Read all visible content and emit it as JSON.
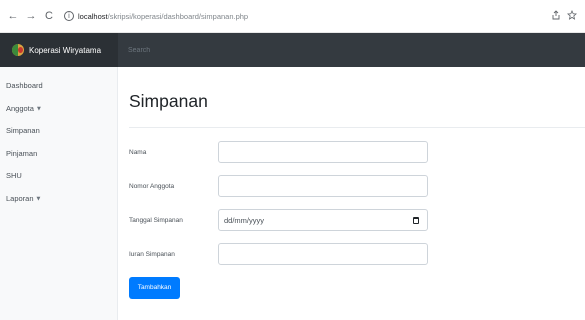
{
  "browser": {
    "back": "←",
    "forward": "→",
    "reload": "C",
    "info": "i",
    "url_host": "localhost",
    "url_path": "/skripsi/koperasi/dashboard/simpanan.php"
  },
  "navbar": {
    "brand": "Koperasi Wiryatama",
    "search_placeholder": "Search"
  },
  "sidebar": {
    "items": [
      {
        "label": "Dashboard"
      },
      {
        "label": "Anggota",
        "caret": "▼"
      },
      {
        "label": "Simpanan"
      },
      {
        "label": "Pinjaman"
      },
      {
        "label": "SHU"
      },
      {
        "label": "Laporan",
        "caret": "▼"
      }
    ]
  },
  "main": {
    "title": "Simpanan",
    "form": {
      "nama_label": "Nama",
      "nama_value": "",
      "nomor_label": "Nomor Anggota",
      "nomor_value": "",
      "tanggal_label": "Tanggal Simpanan",
      "tanggal_placeholder": "dd/mm/yyyy",
      "iuran_label": "Iuran Simpanan",
      "iuran_value": "",
      "submit_label": "Tambahkan"
    }
  },
  "colors": {
    "navbar": "#343a40",
    "brand_bg": "#2b3035",
    "primary": "#007bff",
    "sidebar_bg": "#f8f9fa"
  }
}
